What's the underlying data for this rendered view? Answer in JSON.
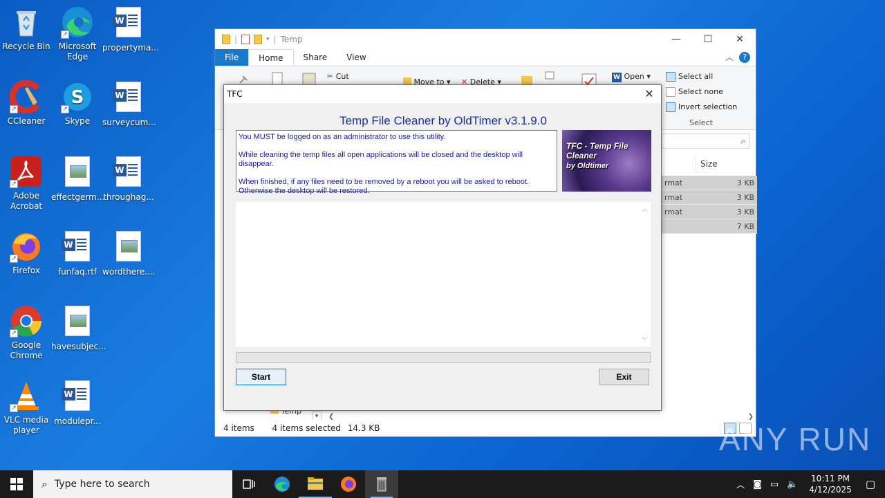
{
  "desktop": {
    "icons": [
      {
        "label": "Recycle Bin",
        "icon": "recycle-bin-icon"
      },
      {
        "label": "Microsoft Edge",
        "icon": "edge-icon"
      },
      {
        "label": "propertyma...",
        "icon": "word-doc-icon"
      },
      {
        "label": "CCleaner",
        "icon": "ccleaner-icon"
      },
      {
        "label": "Skype",
        "icon": "skype-icon"
      },
      {
        "label": "surveycum...",
        "icon": "word-doc-icon"
      },
      {
        "label": "Adobe Acrobat",
        "icon": "acrobat-icon"
      },
      {
        "label": "effectgerm...",
        "icon": "image-file-icon"
      },
      {
        "label": "throughag...",
        "icon": "word-doc-icon"
      },
      {
        "label": "Firefox",
        "icon": "firefox-icon"
      },
      {
        "label": "funfaq.rtf",
        "icon": "word-doc-icon"
      },
      {
        "label": "wordthere....",
        "icon": "image-file-icon"
      },
      {
        "label": "Google Chrome",
        "icon": "chrome-icon"
      },
      {
        "label": "havesubjec...",
        "icon": "image-file-icon"
      },
      {
        "label": "VLC media player",
        "icon": "vlc-icon"
      },
      {
        "label": "modulepr...",
        "icon": "word-doc-icon"
      }
    ]
  },
  "explorer": {
    "title": "Temp",
    "tabs": {
      "file": "File",
      "home": "Home",
      "share": "Share",
      "view": "View"
    },
    "ribbon": {
      "cut": "Cut",
      "move_to": "Move to",
      "delete": "Delete",
      "open": "Open",
      "select_all": "Select all",
      "select_none": "Select none",
      "invert_selection": "Invert selection",
      "select_group": "Select"
    },
    "columns": {
      "size": "Size"
    },
    "rows": [
      {
        "type": "rmat",
        "size": "3 KB"
      },
      {
        "type": "rmat",
        "size": "3 KB"
      },
      {
        "type": "rmat",
        "size": "3 KB"
      },
      {
        "type": "",
        "size": "7 KB"
      }
    ],
    "nav_folder": "Temp",
    "status": {
      "items": "4 items",
      "selected": "4 items selected",
      "size": "14.3 KB"
    }
  },
  "tfc": {
    "window_title": "TFC",
    "heading": "Temp File Cleaner by OldTimer v3.1.9.0",
    "info": {
      "line1": "You MUST be logged on as an administrator to use this utility.",
      "line2": "While cleaning the temp files all open applications will be closed and the desktop will disappear.",
      "line3": "When finished, if any files need to be removed by a reboot you will be asked to reboot.",
      "line4": "Otherwise the desktop will be restored."
    },
    "logo": {
      "title": "TFC - Temp File Cleaner",
      "by": "by Oldtimer"
    },
    "buttons": {
      "start": "Start",
      "exit": "Exit"
    }
  },
  "taskbar": {
    "search_placeholder": "Type here to search",
    "time": "10:11 PM",
    "date": "4/12/2025"
  },
  "watermark": "ANY RUN"
}
